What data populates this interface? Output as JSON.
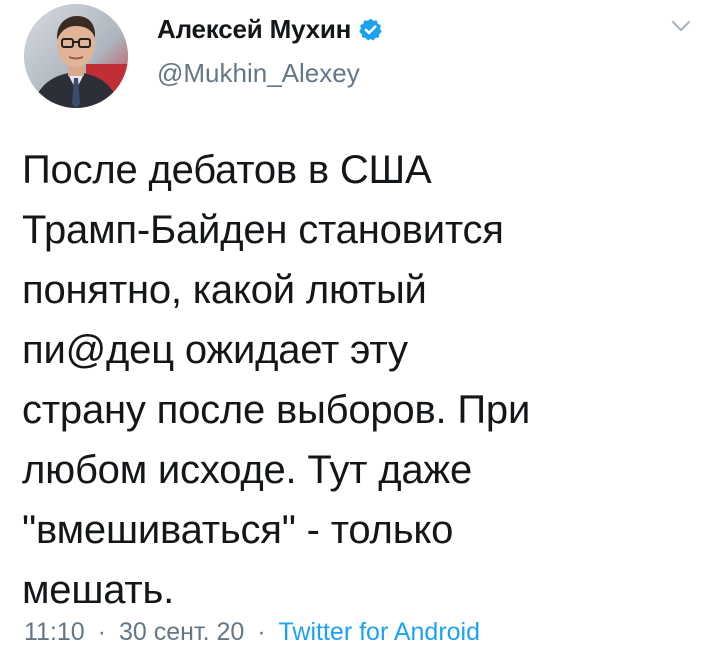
{
  "tweet": {
    "author": {
      "display_name": "Алексей Мухин",
      "handle": "@Mukhin_Alexey",
      "verified": true,
      "verified_color": "#1da1f2"
    },
    "text": "После дебатов в США\nТрамп-Байден становится\nпонятно, какой лютый\nпи@дец ожидает эту\nстрану после выборов. При\nлюбом исходе. Тут даже\n\"вмешиваться\" - только\nмешать.",
    "meta": {
      "time": "11:10",
      "date": "30 сент. 20",
      "separator": "·",
      "source": "Twitter for Android"
    },
    "icons": {
      "avatar": "avatar-photo",
      "verified": "verified-badge-icon",
      "menu": "chevron-down-icon"
    },
    "colors": {
      "text": "#14171a",
      "secondary": "#657786",
      "link": "#1da1f2"
    }
  }
}
